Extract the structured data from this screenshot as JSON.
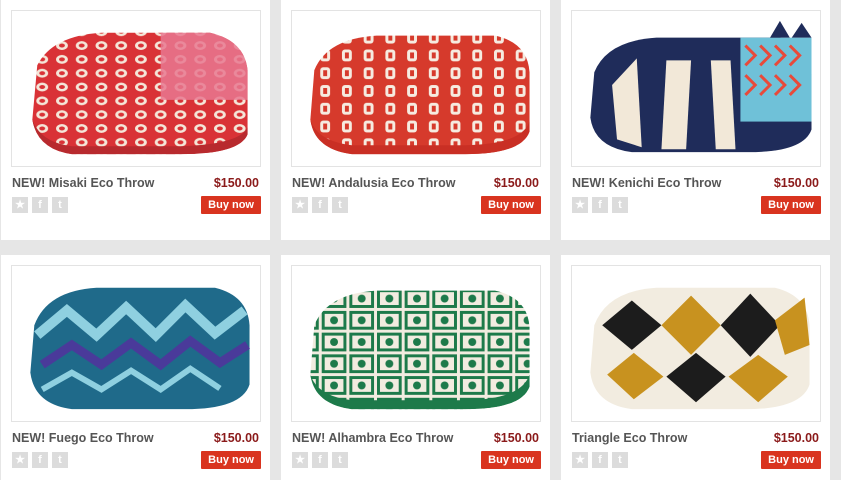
{
  "products": [
    {
      "title": "NEW! Misaki Eco Throw",
      "price": "$150.00",
      "buy_label": "Buy now",
      "image": "misaki-throw-image",
      "colors": [
        "#d93236",
        "#f4e6d8",
        "#e87890"
      ]
    },
    {
      "title": "NEW! Andalusia Eco Throw",
      "price": "$150.00",
      "buy_label": "Buy now",
      "image": "andalusia-throw-image",
      "colors": [
        "#d63a2c",
        "#f6ebe0",
        "#c92f24"
      ]
    },
    {
      "title": "NEW! Kenichi Eco Throw",
      "price": "$150.00",
      "buy_label": "Buy now",
      "image": "kenichi-throw-image",
      "colors": [
        "#1f2c5a",
        "#f2e8d8",
        "#e84a3a",
        "#6fc1d8"
      ]
    },
    {
      "title": "NEW! Fuego Eco Throw",
      "price": "$150.00",
      "buy_label": "Buy now",
      "image": "fuego-throw-image",
      "colors": [
        "#1f6a8a",
        "#8fd0e0",
        "#4a3a9a"
      ]
    },
    {
      "title": "NEW! Alhambra Eco Throw",
      "price": "$150.00",
      "buy_label": "Buy now",
      "image": "alhambra-throw-image",
      "colors": [
        "#1d7a4a",
        "#f2ece0"
      ]
    },
    {
      "title": "Triangle Eco Throw",
      "price": "$150.00",
      "buy_label": "Buy now",
      "image": "triangle-throw-image",
      "colors": [
        "#1c1c1c",
        "#c8921f",
        "#f2ece0"
      ]
    }
  ],
  "icons": {
    "rating": "star-icon",
    "facebook": "facebook-icon",
    "tumblr": "tumblr-icon"
  },
  "icon_glyphs": {
    "star": "★",
    "facebook": "f",
    "tumblr": "t"
  }
}
